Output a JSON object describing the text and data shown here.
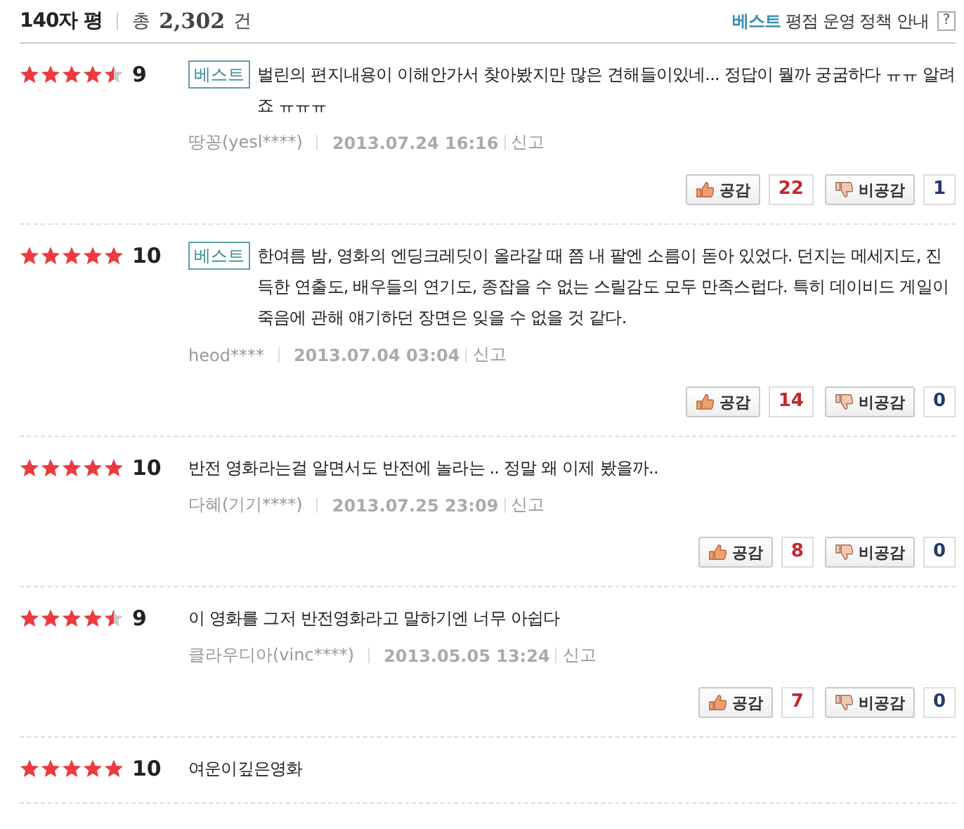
{
  "header": {
    "title": "140자 평",
    "total_prefix": "총",
    "total": "2,302",
    "total_suffix": "건",
    "policy_best": "베스트",
    "policy_text": "평점 운영 정책 안내",
    "help": "?"
  },
  "reviews": [
    {
      "stars": 4.5,
      "score": "9",
      "best": true,
      "best_label": "베스트",
      "text": "벌린의 편지내용이 이해안가서 찾아봤지만 많은 견해들이있네... 정답이 뭘까 궁굼하다 ㅠㅠ 알려죠 ㅠㅠㅠ",
      "author": "땅꽁(yesl****)",
      "date": "2013.07.24 16:16",
      "report": "신고",
      "agree": "공감",
      "agree_count": "22",
      "disagree": "비공감",
      "disagree_count": "1"
    },
    {
      "stars": 5,
      "score": "10",
      "best": true,
      "best_label": "베스트",
      "text": "한여름 밤, 영화의 엔딩크레딧이 올라갈 때 쯤 내 팔엔 소름이 돋아 있었다. 던지는 메세지도, 진득한 연출도, 배우들의 연기도, 종잡을 수 없는 스릴감도 모두 만족스럽다. 특히 데이비드 게일이 죽음에 관해 얘기하던 장면은 잊을 수 없을 것 같다.",
      "author": "heod****",
      "date": "2013.07.04 03:04",
      "report": "신고",
      "agree": "공감",
      "agree_count": "14",
      "disagree": "비공감",
      "disagree_count": "0"
    },
    {
      "stars": 5,
      "score": "10",
      "best": false,
      "text": "반전 영화라는걸 알면서도 반전에 놀라는 .. 정말 왜 이제 봤을까..",
      "author": "다혜(기기****)",
      "date": "2013.07.25 23:09",
      "report": "신고",
      "agree": "공감",
      "agree_count": "8",
      "disagree": "비공감",
      "disagree_count": "0"
    },
    {
      "stars": 4.5,
      "score": "9",
      "best": false,
      "text": "이 영화를 그저 반전영화라고 말하기엔 너무 아쉽다",
      "author": "클라우디아(vinc****)",
      "date": "2013.05.05 13:24",
      "report": "신고",
      "agree": "공감",
      "agree_count": "7",
      "disagree": "비공감",
      "disagree_count": "0"
    },
    {
      "stars": 5,
      "score": "10",
      "best": false,
      "text": "여운이깊은영화"
    }
  ]
}
